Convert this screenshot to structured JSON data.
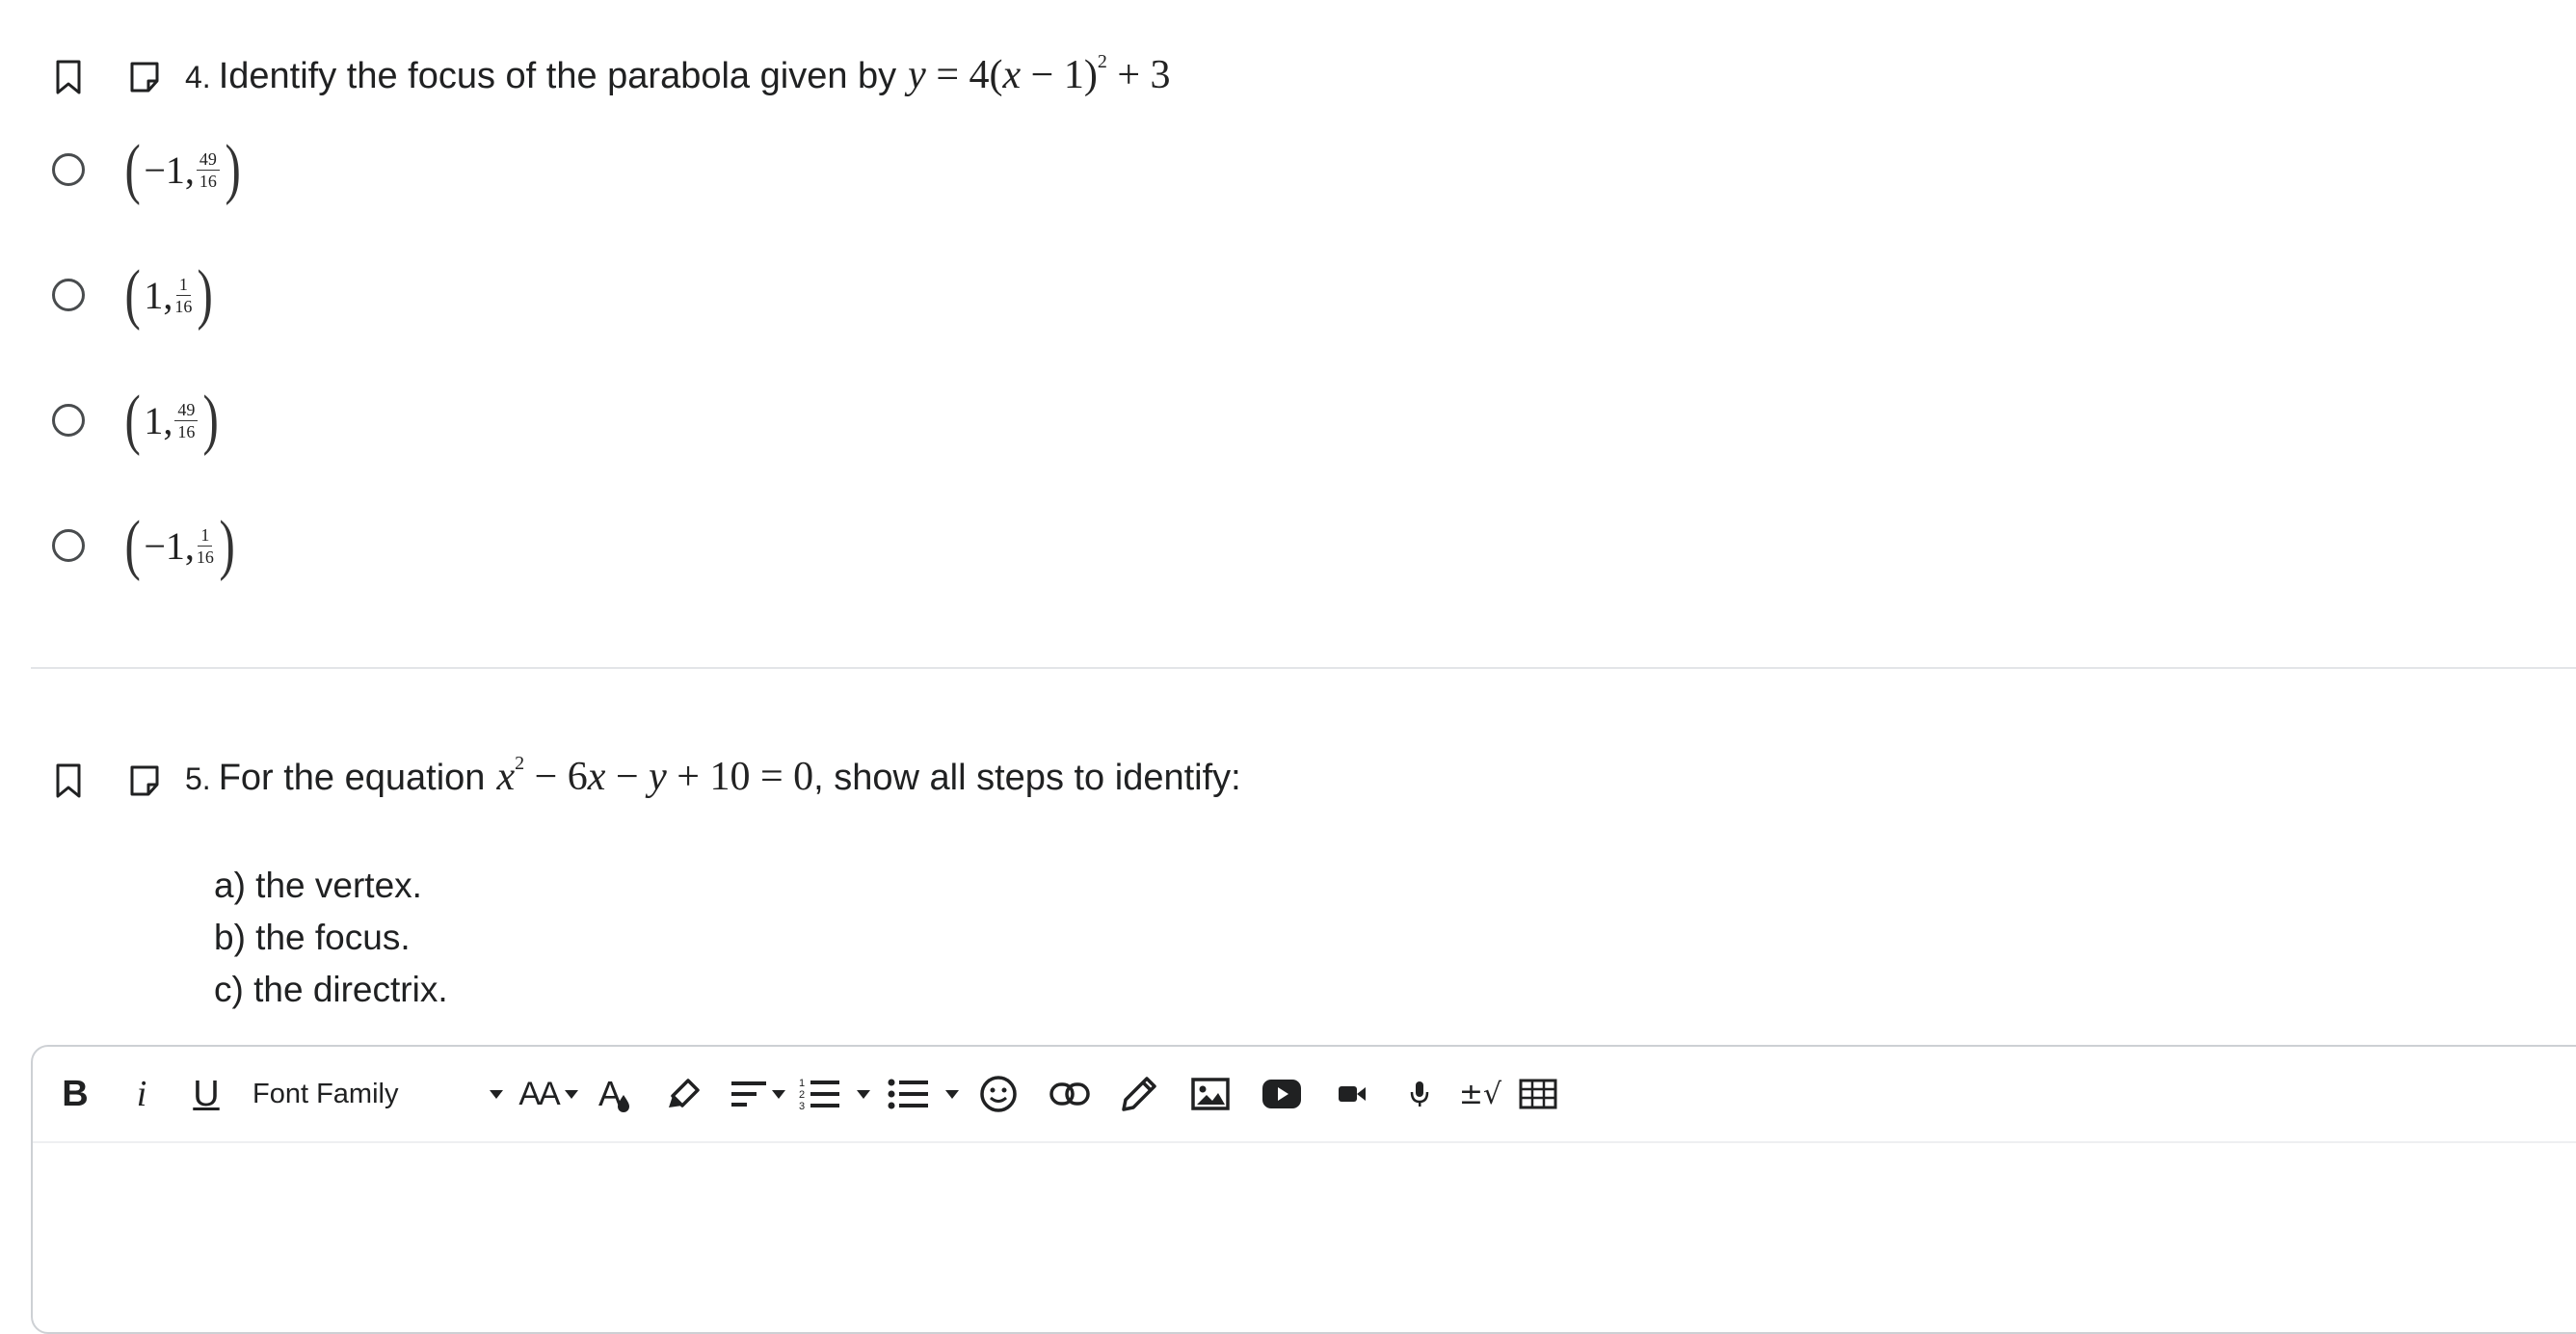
{
  "questions": [
    {
      "number": "4.",
      "prompt": "Identify the focus of the parabola given by",
      "equation": {
        "lhs": "y",
        "eq": " = 4(",
        "var": "x",
        "rest": " − 1)",
        "exp": "2",
        "tail": " + 3"
      },
      "options": [
        {
          "sign": "−1,",
          "num": "49",
          "den": "16"
        },
        {
          "sign": "1,",
          "num": "1",
          "den": "16"
        },
        {
          "sign": "1,",
          "num": "49",
          "den": "16"
        },
        {
          "sign": "−1,",
          "num": "1",
          "den": "16"
        }
      ]
    },
    {
      "number": "5.",
      "prompt": "For the equation",
      "equation": {
        "v1": "x",
        "exp": "2",
        "rest1": " − 6",
        "v2": "x",
        "rest2": " − ",
        "v3": "y",
        "rest3": " + 10 = 0"
      },
      "suffix": ", show all steps to identify:",
      "subitems": [
        "a) the vertex.",
        "b) the focus.",
        "c) the directrix."
      ]
    }
  ],
  "editor": {
    "bold": "B",
    "italic": "i",
    "underline": "U",
    "font_family": "Font Family",
    "font_size_glyph": "AA",
    "color_glyph": "A",
    "equation_glyph": "±√"
  }
}
